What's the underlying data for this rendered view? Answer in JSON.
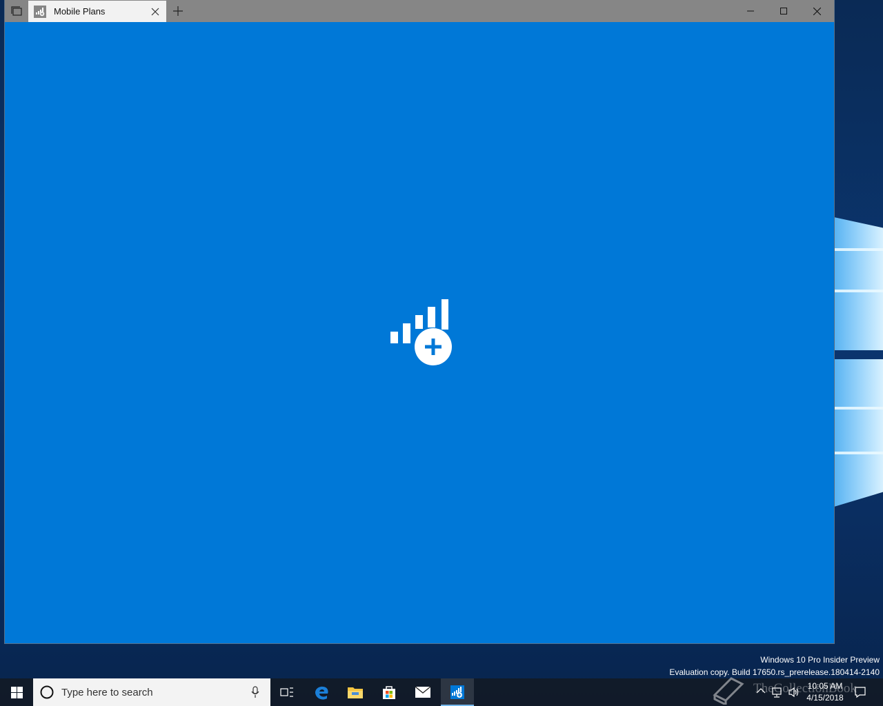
{
  "window": {
    "tab_title": "Mobile Plans",
    "accent": "#0078d7",
    "titlebar_color": "#868686"
  },
  "icons": {
    "task_view": "task-view-icon",
    "tab_app": "mobile-plans-icon",
    "close_tab": "close-icon",
    "new_tab": "plus-icon",
    "minimize": "minimize-icon",
    "maximize": "maximize-icon",
    "close_window": "close-icon",
    "splash": "signal-plus-icon"
  },
  "watermark": {
    "line1": "Windows 10 Pro Insider Preview",
    "line2": "Evaluation copy. Build 17650.rs_prerelease.180414-2140",
    "overlay": "TheCollectionBook"
  },
  "taskbar": {
    "search_placeholder": "Type here to search",
    "time": "10:05 AM",
    "date": "4/15/2018"
  }
}
